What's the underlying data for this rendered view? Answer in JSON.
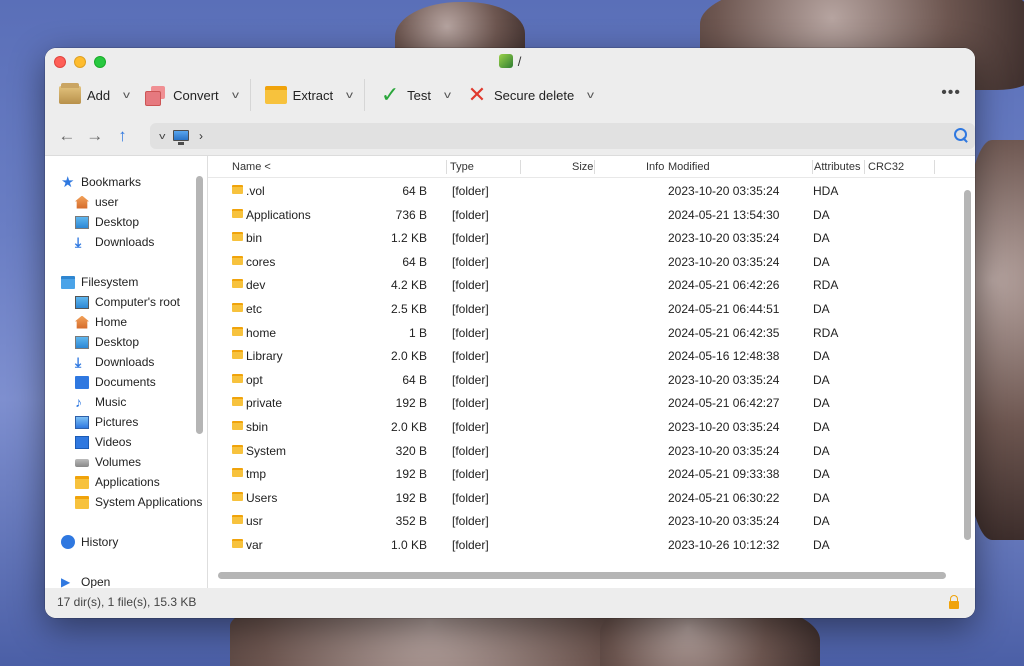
{
  "window": {
    "title": "/"
  },
  "toolbar": {
    "add": "Add",
    "convert": "Convert",
    "extract": "Extract",
    "test": "Test",
    "secure_delete": "Secure delete",
    "more": "•••"
  },
  "navbar": {
    "path_separator": "›"
  },
  "sidebar": {
    "bookmarks": {
      "title": "Bookmarks",
      "items": [
        {
          "label": "user",
          "icon": "home-icon"
        },
        {
          "label": "Desktop",
          "icon": "desktop-icon"
        },
        {
          "label": "Downloads",
          "icon": "downloads-icon"
        }
      ]
    },
    "filesystem": {
      "title": "Filesystem",
      "items": [
        {
          "label": "Computer's root",
          "icon": "computer-icon"
        },
        {
          "label": "Home",
          "icon": "home-icon"
        },
        {
          "label": "Desktop",
          "icon": "desktop-icon"
        },
        {
          "label": "Downloads",
          "icon": "downloads-icon"
        },
        {
          "label": "Documents",
          "icon": "documents-icon"
        },
        {
          "label": "Music",
          "icon": "music-icon"
        },
        {
          "label": "Pictures",
          "icon": "pictures-icon"
        },
        {
          "label": "Videos",
          "icon": "videos-icon"
        },
        {
          "label": "Volumes",
          "icon": "volumes-icon"
        },
        {
          "label": "Applications",
          "icon": "folder-icon"
        },
        {
          "label": "System Applications",
          "icon": "folder-icon"
        }
      ]
    },
    "history": "History",
    "open": "Open"
  },
  "columns": {
    "name": "Name <",
    "type": "Type",
    "size": "Size",
    "info": "Info",
    "modified": "Modified",
    "attributes": "Attributes",
    "crc32": "CRC32"
  },
  "files": [
    {
      "name": ".vol",
      "type": "[folder]",
      "size": "64 B",
      "modified": "2023-10-20 03:35:24",
      "attributes": "HDA"
    },
    {
      "name": "Applications",
      "type": "[folder]",
      "size": "736 B",
      "modified": "2024-05-21 13:54:30",
      "attributes": "DA"
    },
    {
      "name": "bin",
      "type": "[folder]",
      "size": "1.2 KB",
      "modified": "2023-10-20 03:35:24",
      "attributes": "DA"
    },
    {
      "name": "cores",
      "type": "[folder]",
      "size": "64 B",
      "modified": "2023-10-20 03:35:24",
      "attributes": "DA"
    },
    {
      "name": "dev",
      "type": "[folder]",
      "size": "4.2 KB",
      "modified": "2024-05-21 06:42:26",
      "attributes": "RDA"
    },
    {
      "name": "etc",
      "type": "[folder]",
      "size": "2.5 KB",
      "modified": "2024-05-21 06:44:51",
      "attributes": "DA"
    },
    {
      "name": "home",
      "type": "[folder]",
      "size": "1 B",
      "modified": "2024-05-21 06:42:35",
      "attributes": "RDA"
    },
    {
      "name": "Library",
      "type": "[folder]",
      "size": "2.0 KB",
      "modified": "2024-05-16 12:48:38",
      "attributes": "DA"
    },
    {
      "name": "opt",
      "type": "[folder]",
      "size": "64 B",
      "modified": "2023-10-20 03:35:24",
      "attributes": "DA"
    },
    {
      "name": "private",
      "type": "[folder]",
      "size": "192 B",
      "modified": "2024-05-21 06:42:27",
      "attributes": "DA"
    },
    {
      "name": "sbin",
      "type": "[folder]",
      "size": "2.0 KB",
      "modified": "2023-10-20 03:35:24",
      "attributes": "DA"
    },
    {
      "name": "System",
      "type": "[folder]",
      "size": "320 B",
      "modified": "2023-10-20 03:35:24",
      "attributes": "DA"
    },
    {
      "name": "tmp",
      "type": "[folder]",
      "size": "192 B",
      "modified": "2024-05-21 09:33:38",
      "attributes": "DA"
    },
    {
      "name": "Users",
      "type": "[folder]",
      "size": "192 B",
      "modified": "2024-05-21 06:30:22",
      "attributes": "DA"
    },
    {
      "name": "usr",
      "type": "[folder]",
      "size": "352 B",
      "modified": "2023-10-20 03:35:24",
      "attributes": "DA"
    },
    {
      "name": "var",
      "type": "[folder]",
      "size": "1.0 KB",
      "modified": "2023-10-26 10:12:32",
      "attributes": "DA"
    }
  ],
  "status": {
    "summary": "17 dir(s), 1 file(s), 15.3 KB"
  }
}
